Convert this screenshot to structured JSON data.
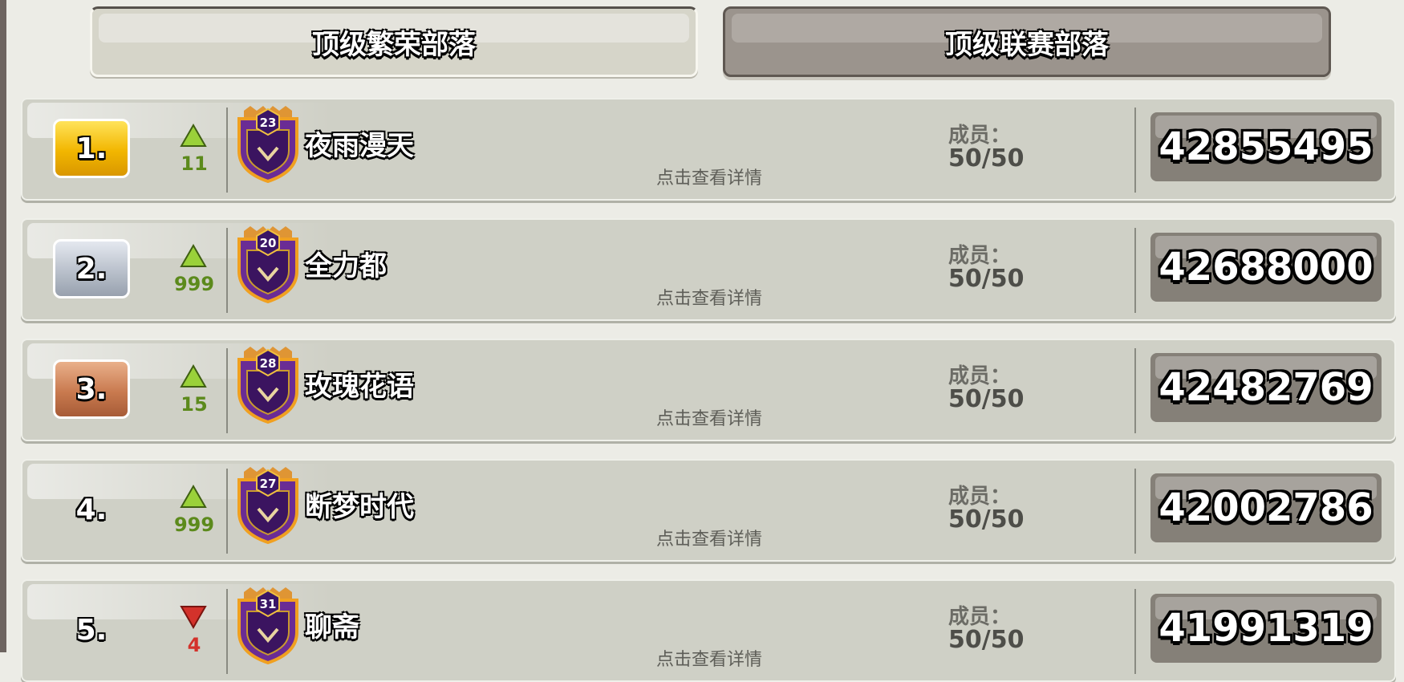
{
  "tabs": [
    {
      "label": "顶级繁荣部落",
      "active": true
    },
    {
      "label": "顶级联赛部落",
      "active": false
    }
  ],
  "colors": {
    "trend_up": "#9ad13a",
    "trend_down": "#d3322b",
    "badge_purple": "#5b2a86"
  },
  "clans": [
    {
      "rank": "1.",
      "rank_style": "gold",
      "trend": "up",
      "trend_value": "11",
      "badge_level": "23",
      "name": "夜雨漫天",
      "details": "点击查看详情",
      "members_label": "成员：",
      "members": "50/50",
      "trophies": "42855495"
    },
    {
      "rank": "2.",
      "rank_style": "silver",
      "trend": "up",
      "trend_value": "999",
      "badge_level": "20",
      "name": "全力都",
      "details": "点击查看详情",
      "members_label": "成员：",
      "members": "50/50",
      "trophies": "42688000"
    },
    {
      "rank": "3.",
      "rank_style": "bronze",
      "trend": "up",
      "trend_value": "15",
      "badge_level": "28",
      "name": "玫瑰花语",
      "details": "点击查看详情",
      "members_label": "成员：",
      "members": "50/50",
      "trophies": "42482769"
    },
    {
      "rank": "4.",
      "rank_style": "plain",
      "trend": "up",
      "trend_value": "999",
      "badge_level": "27",
      "name": "断梦时代",
      "details": "点击查看详情",
      "members_label": "成员：",
      "members": "50/50",
      "trophies": "42002786"
    },
    {
      "rank": "5.",
      "rank_style": "plain",
      "trend": "down",
      "trend_value": "4",
      "badge_level": "31",
      "name": "聊斋",
      "details": "点击查看详情",
      "members_label": "成员：",
      "members": "50/50",
      "trophies": "41991319"
    }
  ]
}
